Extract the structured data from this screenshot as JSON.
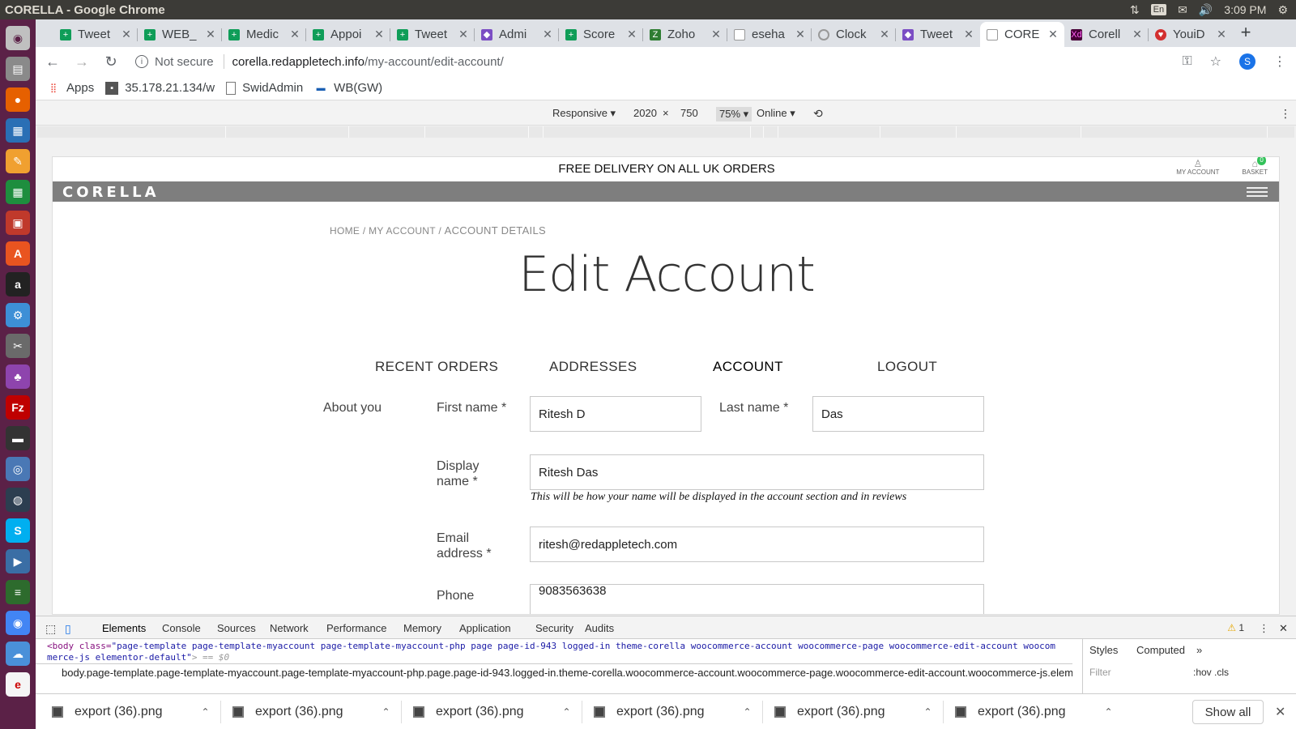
{
  "os": {
    "window_title": "CORELLA - Google Chrome",
    "lang": "En",
    "clock": "3:09 PM"
  },
  "tabs": [
    {
      "label": "Tweet",
      "icon": "sheets-icon",
      "color": "#0f9d58"
    },
    {
      "label": "WEB_",
      "icon": "sheets-icon",
      "color": "#0f9d58"
    },
    {
      "label": "Medic",
      "icon": "sheets-icon",
      "color": "#0f9d58"
    },
    {
      "label": "Appoi",
      "icon": "sheets-icon",
      "color": "#0f9d58"
    },
    {
      "label": "Tweet",
      "icon": "sheets-icon",
      "color": "#0f9d58"
    },
    {
      "label": "Admi",
      "icon": "gem-icon",
      "color": "#7b4dc4"
    },
    {
      "label": "Score",
      "icon": "sheets-icon",
      "color": "#0f9d58"
    },
    {
      "label": "Zoho",
      "icon": "zoho-icon",
      "color": "#2e7d32"
    },
    {
      "label": "eseha",
      "icon": "page-icon",
      "color": "#999999"
    },
    {
      "label": "Clock",
      "icon": "loading-icon",
      "color": "#999999"
    },
    {
      "label": "Tweet",
      "icon": "gem-icon",
      "color": "#7b4dc4"
    },
    {
      "label": "CORE",
      "icon": "page-icon",
      "color": "#999999",
      "active": true
    },
    {
      "label": "Corell",
      "icon": "xd-icon",
      "color": "#470137"
    },
    {
      "label": "YouiD",
      "icon": "shield-icon",
      "color": "#d32f2f"
    }
  ],
  "address": {
    "security": "Not secure",
    "host": "corella.redappletech.info",
    "path": "/my-account/edit-account/"
  },
  "bookmarks": [
    {
      "label": "Apps",
      "icon": "apps-grid-icon"
    },
    {
      "label": "35.178.21.134/w",
      "icon": "site-icon"
    },
    {
      "label": "SwidAdmin",
      "icon": "page-icon"
    },
    {
      "label": "WB(GW)",
      "icon": "site-icon"
    }
  ],
  "device_toolbar": {
    "mode": "Responsive ▾",
    "width": "2020",
    "times": "×",
    "height": "750",
    "zoom": "75% ▾",
    "network": "Online ▾"
  },
  "site": {
    "announcement": "FREE DELIVERY ON ALL UK ORDERS",
    "my_account": "MY ACCOUNT",
    "basket": "BASKET",
    "basket_count": "0",
    "logo": "CORELLA",
    "breadcrumb": {
      "home": "HOME",
      "sep": " / ",
      "account": "MY ACCOUNT",
      "current": "ACCOUNT DETAILS"
    },
    "page_title": "Edit Account",
    "account_nav": [
      "RECENT ORDERS",
      "ADDRESSES",
      "ACCOUNT",
      "LOGOUT"
    ],
    "section_label": "About you",
    "form": {
      "first_name_label": "First name *",
      "first_name_value": "Ritesh D",
      "last_name_label": "Last name *",
      "last_name_value": "Das",
      "display_name_label_1": "Display",
      "display_name_label_2": "name *",
      "display_name_value": "Ritesh Das",
      "display_name_hint": "This will be how your name will be displayed in the account section and in reviews",
      "email_label_1": "Email",
      "email_label_2": "address *",
      "email_value": "ritesh@redappletech.com",
      "phone_label": "Phone",
      "phone_value": "9083563638"
    }
  },
  "devtools": {
    "tabs": [
      "Elements",
      "Console",
      "Sources",
      "Network",
      "Performance",
      "Memory",
      "Application",
      "Security",
      "Audits"
    ],
    "warnings": "1",
    "code_tag": "<body class=",
    "code_classes": "\"page-template page-template-myaccount page-template-myaccount-php page page-id-943 logged-in theme-corella woocommerce-account woocommerce-page woocommerce-edit-account woocommerce-js elementor-default\"",
    "code_tail": "> == $0",
    "breadcrumb": "body.page-template.page-template-myaccount.page-template-myaccount-php.page.page-id-943.logged-in.theme-corella.woocommerce-account.woocommerce-page.woocommerce-edit-account.woocommerce-js.elementor-default",
    "sidebar_tabs": [
      "Styles",
      "Computed"
    ],
    "filter_placeholder": "Filter",
    "hov_cls": ":hov .cls"
  },
  "downloads": {
    "files": [
      "export (36).png",
      "export (36).png",
      "export (36).png",
      "export (36).png",
      "export (36).png",
      "export (36).png"
    ],
    "show_all": "Show all"
  }
}
